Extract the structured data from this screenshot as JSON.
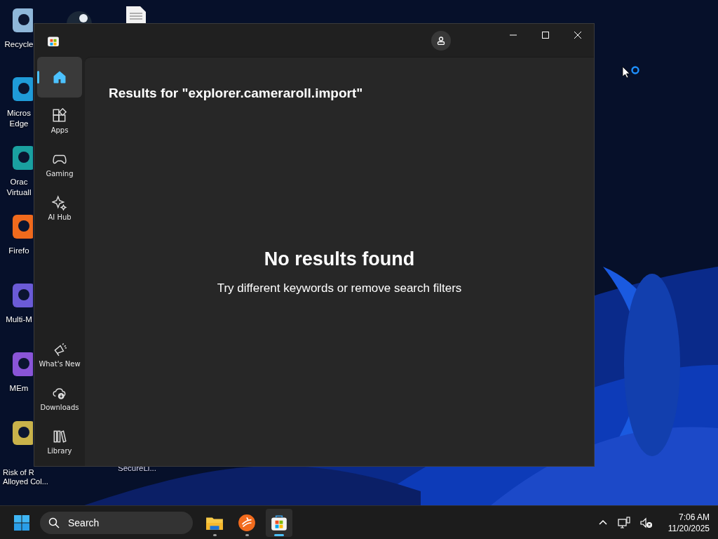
{
  "desktop": {
    "icons": [
      {
        "label": "Recycle"
      },
      {
        "label": "Micros Edge"
      },
      {
        "label": "Orac Virtuall"
      },
      {
        "label": "Firefo"
      },
      {
        "label": "Multi-M"
      },
      {
        "label": "MEm"
      },
      {
        "label": "Risk of R Alloyed Col..."
      }
    ],
    "second_column_label": "SecureLi..."
  },
  "window": {
    "nav_items": [
      {
        "selected": true
      },
      {
        "label": "Apps",
        "selected": false
      },
      {
        "label": "Gaming",
        "selected": false
      },
      {
        "label": "AI Hub",
        "selected": false
      },
      {
        "label": "What's New",
        "selected": false
      },
      {
        "label": "Downloads",
        "selected": false
      },
      {
        "label": "Library",
        "selected": false
      }
    ],
    "results_heading": "Results for \"explorer.cameraroll.import\"",
    "empty_title": "No results found",
    "empty_message": "Try different keywords or remove search filters"
  },
  "taskbar": {
    "search": {
      "placeholder": "Search"
    },
    "apps": [
      {
        "selected": false
      },
      {
        "selected": false
      },
      {
        "selected": true
      }
    ],
    "time": "7:06 AM",
    "date": "11/20/2025"
  }
}
